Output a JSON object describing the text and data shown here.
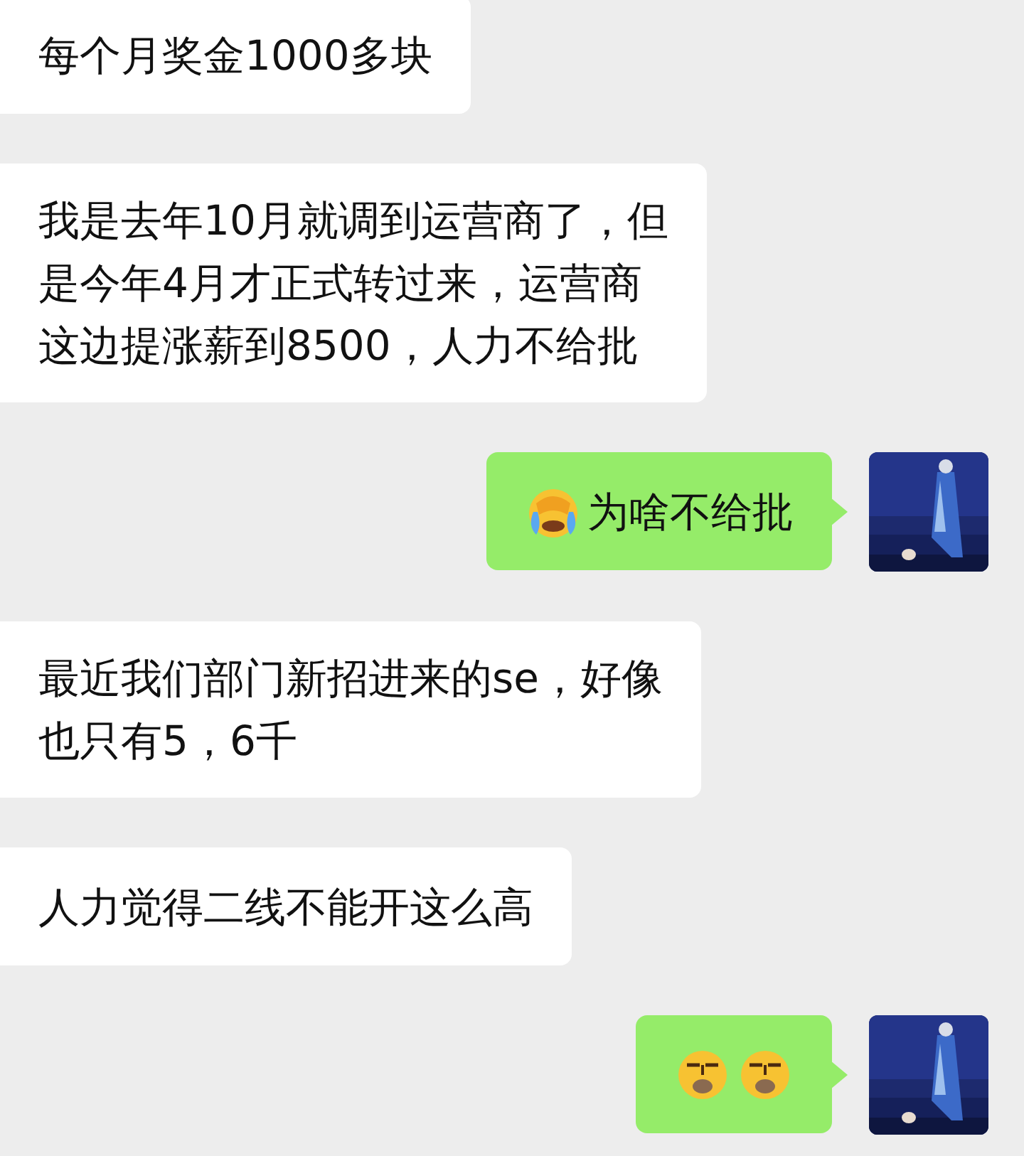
{
  "messages": [
    {
      "kind": "received",
      "parts": [
        {
          "kind": "text",
          "lines": [
            "每个月奖金1000多块"
          ]
        }
      ]
    },
    {
      "kind": "received",
      "parts": [
        {
          "kind": "text",
          "lines": [
            "我是去年10月就调到运营商了，但",
            "是今年4月才正式转过来，运营商",
            "这边提涨薪到8500，人力不给批"
          ]
        }
      ]
    },
    {
      "kind": "sent",
      "parts": [
        {
          "kind": "cry"
        },
        {
          "kind": "text",
          "lines": [
            "为啥不给批"
          ]
        }
      ]
    },
    {
      "kind": "received",
      "parts": [
        {
          "kind": "text",
          "lines": [
            "最近我们部门新招进来的se，好像",
            "也只有5，6千"
          ]
        }
      ]
    },
    {
      "kind": "received",
      "parts": [
        {
          "kind": "text",
          "lines": [
            "人力觉得二线不能开这么高"
          ]
        }
      ]
    },
    {
      "kind": "sent",
      "parts": [
        {
          "kind": "frown"
        },
        {
          "kind": "frown"
        }
      ]
    }
  ]
}
